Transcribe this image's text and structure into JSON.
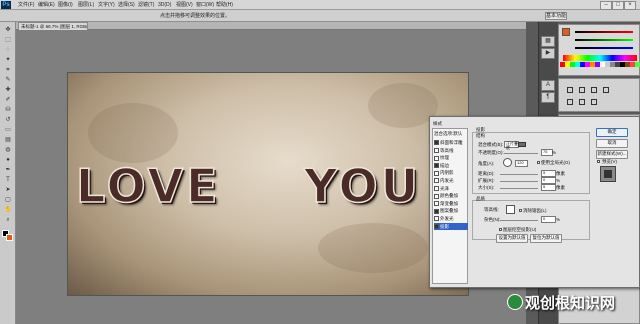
{
  "menubar": {
    "logo": "Ps",
    "items": [
      "文件(F)",
      "编辑(E)",
      "图像(I)",
      "图层(L)",
      "文字(Y)",
      "选择(S)",
      "滤镜(T)",
      "3D(D)",
      "视图(V)",
      "窗口(W)",
      "帮助(H)"
    ],
    "window_buttons": [
      "–",
      "□",
      "×"
    ]
  },
  "options_bar": {
    "text": "点击并拖移可调整效果的位置。",
    "button": "基本功能"
  },
  "document": {
    "tab_label": "未标题-1 @ 66.7% (图层 1, RGB/8)"
  },
  "canvas": {
    "text_left": "LOVE",
    "text_right": "YOU"
  },
  "layer_style": {
    "left_header": "样式",
    "blend_options": "混合选项:默认",
    "items": [
      {
        "label": "斜面和浮雕",
        "checked": true
      },
      {
        "label": "等高线",
        "checked": false
      },
      {
        "label": "纹理",
        "checked": false
      },
      {
        "label": "描边",
        "checked": true
      },
      {
        "label": "内阴影",
        "checked": false
      },
      {
        "label": "内发光",
        "checked": false
      },
      {
        "label": "光泽",
        "checked": false
      },
      {
        "label": "颜色叠加",
        "checked": false
      },
      {
        "label": "渐变叠加",
        "checked": false
      },
      {
        "label": "图案叠加",
        "checked": true
      },
      {
        "label": "外发光",
        "checked": false
      },
      {
        "label": "投影",
        "checked": true
      }
    ],
    "section_title": "投影",
    "structure_title": "结构",
    "blend_mode_label": "混合模式(B):",
    "blend_mode_value": "正片叠底",
    "opacity_label": "不透明度(O):",
    "opacity_value": "75",
    "angle_label": "角度(A):",
    "angle_value": "120",
    "global_light_label": "使用全局光(G)",
    "distance_label": "距离(D):",
    "distance_value": "5",
    "spread_label": "扩展(R):",
    "spread_value": "0",
    "size_label": "大小(S):",
    "size_value": "5",
    "unit_px": "像素",
    "unit_pct": "%",
    "quality_title": "品质",
    "contour_label": "等高线:",
    "anti_alias_label": "消除锯齿(L)",
    "noise_label": "杂色(N):",
    "noise_value": "0",
    "knockout_label": "图层挖空投影(U)",
    "make_default": "设置为默认值",
    "reset_default": "复位为默认值",
    "ok": "确定",
    "cancel": "取消",
    "new_style": "新建样式(W)...",
    "preview": "预览(V)"
  },
  "watermark": {
    "text": "观创根知识网"
  },
  "colors": {
    "accent": "#3463c9",
    "text_fill": "#4b2b27",
    "canvas_light": "#e7dccb",
    "canvas_dark": "#6b5a48"
  }
}
